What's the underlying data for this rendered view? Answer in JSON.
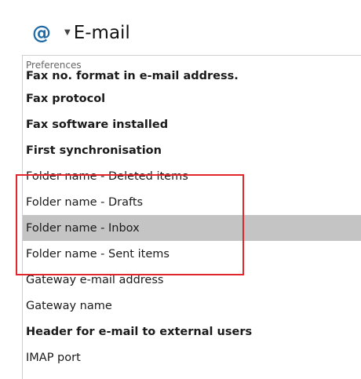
{
  "header": {
    "icon": "at-sign-icon",
    "dropdown_icon": "dropdown-arrow-icon",
    "title": "E-mail"
  },
  "section": {
    "label": "Preferences"
  },
  "rows": [
    {
      "label": "Fax no. format in e-mail address.",
      "bold": true
    },
    {
      "label": "Fax protocol",
      "bold": true
    },
    {
      "label": "Fax software installed",
      "bold": true
    },
    {
      "label": "First synchronisation",
      "bold": true
    },
    {
      "label": "Folder name - Deleted items",
      "bold": false
    },
    {
      "label": "Folder name - Drafts",
      "bold": false
    },
    {
      "label": "Folder name - Inbox",
      "bold": false,
      "selected": true
    },
    {
      "label": "Folder name - Sent items",
      "bold": false
    },
    {
      "label": "Gateway e-mail address",
      "bold": false
    },
    {
      "label": "Gateway name",
      "bold": false
    },
    {
      "label": "Header for e-mail to external users",
      "bold": true
    },
    {
      "label": "IMAP port",
      "bold": false
    }
  ],
  "colors": {
    "highlight_border": "#e1252a",
    "selected_row": "#c4c4c4",
    "icon_accent": "#1f6aa5"
  }
}
